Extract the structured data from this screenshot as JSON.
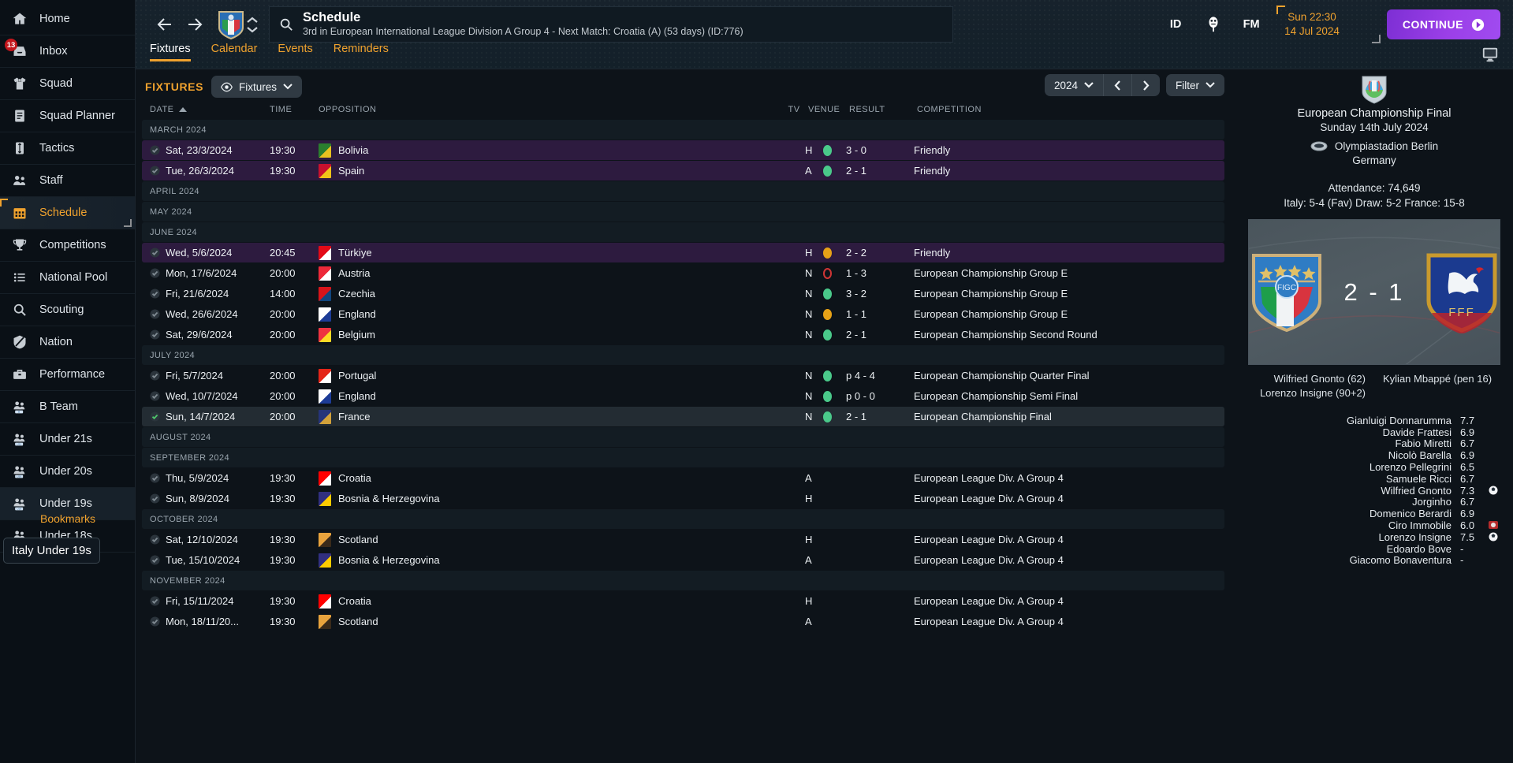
{
  "sidebar": {
    "items": [
      {
        "label": "Home",
        "icon": "home-icon",
        "badge": null
      },
      {
        "label": "Inbox",
        "icon": "inbox-icon",
        "badge": "13"
      },
      {
        "label": "Squad",
        "icon": "shirt-icon",
        "badge": null
      },
      {
        "label": "Squad Planner",
        "icon": "document-icon",
        "badge": null
      },
      {
        "label": "Tactics",
        "icon": "tactics-icon",
        "badge": null
      },
      {
        "label": "Staff",
        "icon": "staff-icon",
        "badge": null
      },
      {
        "label": "Schedule",
        "icon": "calendar-icon",
        "badge": null
      },
      {
        "label": "Competitions",
        "icon": "trophy-icon",
        "badge": null
      },
      {
        "label": "National Pool",
        "icon": "list-icon",
        "badge": null
      },
      {
        "label": "Scouting",
        "icon": "search-icon",
        "badge": null
      },
      {
        "label": "Nation",
        "icon": "shield-icon",
        "badge": null
      },
      {
        "label": "Performance",
        "icon": "briefcase-icon",
        "badge": null
      },
      {
        "label": "B Team",
        "icon": "team-b-icon",
        "badge": null
      },
      {
        "label": "Under 21s",
        "icon": "team-u21-icon",
        "badge": null
      },
      {
        "label": "Under 20s",
        "icon": "team-u20-icon",
        "badge": null
      },
      {
        "label": "Under 19s",
        "icon": "team-u19-icon",
        "badge": null
      },
      {
        "label": "Under 18s",
        "icon": "team-u18-icon",
        "badge": null
      }
    ],
    "selected": "Schedule",
    "highlighted": "Under 19s",
    "bookmarks_label": "Bookmarks",
    "tooltip": "Italy Under 19s"
  },
  "header": {
    "title": "Schedule",
    "subtitle": "3rd in European International League Division A Group 4 - Next Match: Croatia (A) (53 days) (ID:776)",
    "icons": [
      "back-arrow-icon",
      "forward-arrow-icon",
      "team-crest-icon",
      "up-down-icon",
      "search-icon"
    ],
    "right_icons": [
      "ID",
      "podcast-icon",
      "FM"
    ],
    "date_time": "Sun 22:30",
    "date_day": "14 Jul 2024",
    "continue_label": "CONTINUE",
    "tabs": [
      {
        "label": "Fixtures",
        "active": true
      },
      {
        "label": "Calendar",
        "active": false
      },
      {
        "label": "Events",
        "active": false
      },
      {
        "label": "Reminders",
        "active": false
      }
    ]
  },
  "toolbar": {
    "section_title": "FIXTURES",
    "view_pill": "Fixtures",
    "year": "2024",
    "filter_label": "Filter",
    "prev_icon": "chevron-left-icon",
    "next_icon": "chevron-right-icon"
  },
  "table": {
    "columns": [
      "DATE",
      "TIME",
      "OPPOSITION",
      "TV",
      "VENUE",
      "RESULT",
      "COMPETITION"
    ],
    "sort_column": "DATE",
    "rows": [
      {
        "type": "month",
        "label": "MARCH 2024"
      },
      {
        "type": "match",
        "date": "Sat, 23/3/2024",
        "time": "19:30",
        "opposition": "Bolivia",
        "flag": "#2a7d2e",
        "flag2": "#e8c120",
        "tv": "",
        "venue": "H",
        "result_dot": "w",
        "result": "3 - 0",
        "competition": "Friendly",
        "played": true,
        "highlight": "res"
      },
      {
        "type": "match",
        "date": "Tue, 26/3/2024",
        "time": "19:30",
        "opposition": "Spain",
        "flag": "#c8102e",
        "flag2": "#f0c419",
        "tv": "",
        "venue": "A",
        "result_dot": "w",
        "result": "2 - 1",
        "competition": "Friendly",
        "played": true,
        "highlight": "res"
      },
      {
        "type": "month",
        "label": "APRIL 2024"
      },
      {
        "type": "month",
        "label": "MAY 2024"
      },
      {
        "type": "month",
        "label": "JUNE 2024"
      },
      {
        "type": "match",
        "date": "Wed, 5/6/2024",
        "time": "20:45",
        "opposition": "Türkiye",
        "flag": "#e30a17",
        "flag2": "#ffffff",
        "tv": "",
        "venue": "H",
        "result_dot": "d",
        "result": "2 - 2",
        "competition": "Friendly",
        "played": true,
        "highlight": "res"
      },
      {
        "type": "match",
        "date": "Mon, 17/6/2024",
        "time": "20:00",
        "opposition": "Austria",
        "flag": "#ed2939",
        "flag2": "#ffffff",
        "tv": "",
        "venue": "N",
        "result_dot": "l",
        "result": "1 - 3",
        "competition": "European Championship Group E",
        "played": true,
        "highlight": ""
      },
      {
        "type": "match",
        "date": "Fri, 21/6/2024",
        "time": "14:00",
        "opposition": "Czechia",
        "flag": "#d7141a",
        "flag2": "#11457e",
        "tv": "",
        "venue": "N",
        "result_dot": "w",
        "result": "3 - 2",
        "competition": "European Championship Group E",
        "played": true,
        "highlight": ""
      },
      {
        "type": "match",
        "date": "Wed, 26/6/2024",
        "time": "20:00",
        "opposition": "England",
        "flag": "#ffffff",
        "flag2": "#1d3c97",
        "tv": "",
        "venue": "N",
        "result_dot": "d",
        "result": "1 - 1",
        "competition": "European Championship Group E",
        "played": true,
        "highlight": ""
      },
      {
        "type": "match",
        "date": "Sat, 29/6/2024",
        "time": "20:00",
        "opposition": "Belgium",
        "flag": "#ef3340",
        "flag2": "#fdda24",
        "tv": "",
        "venue": "N",
        "result_dot": "w",
        "result": "2 - 1",
        "competition": "European Championship Second Round",
        "played": true,
        "highlight": ""
      },
      {
        "type": "month",
        "label": "JULY 2024"
      },
      {
        "type": "match",
        "date": "Fri, 5/7/2024",
        "time": "20:00",
        "opposition": "Portugal",
        "flag": "#e42518",
        "flag2": "#ffffff",
        "tv": "",
        "venue": "N",
        "result_dot": "w",
        "result": "p 4 - 4",
        "competition": "European Championship Quarter Final",
        "played": true,
        "highlight": ""
      },
      {
        "type": "match",
        "date": "Wed, 10/7/2024",
        "time": "20:00",
        "opposition": "England",
        "flag": "#ffffff",
        "flag2": "#1d3c97",
        "tv": "",
        "venue": "N",
        "result_dot": "w",
        "result": "p 0 - 0",
        "competition": "European Championship Semi Final",
        "played": true,
        "highlight": ""
      },
      {
        "type": "match",
        "date": "Sun, 14/7/2024",
        "time": "20:00",
        "opposition": "France",
        "flag": "#26347a",
        "flag2": "#d2a13a",
        "tv": "",
        "venue": "N",
        "result_dot": "w",
        "result": "2 - 1",
        "competition": "European Championship Final",
        "played": true,
        "highlight": "cur",
        "done": true
      },
      {
        "type": "month",
        "label": "AUGUST 2024"
      },
      {
        "type": "month",
        "label": "SEPTEMBER 2024"
      },
      {
        "type": "match",
        "date": "Thu, 5/9/2024",
        "time": "19:30",
        "opposition": "Croatia",
        "flag": "#ff0000",
        "flag2": "#ffffff",
        "tv": "",
        "venue": "A",
        "result_dot": "",
        "result": "",
        "competition": "European League Div. A Group 4",
        "played": false,
        "highlight": ""
      },
      {
        "type": "match",
        "date": "Sun, 8/9/2024",
        "time": "19:30",
        "opposition": "Bosnia & Herzegovina",
        "flag": "#312f80",
        "flag2": "#fecb00",
        "tv": "",
        "venue": "H",
        "result_dot": "",
        "result": "",
        "competition": "European League Div. A Group 4",
        "played": false,
        "highlight": ""
      },
      {
        "type": "month",
        "label": "OCTOBER 2024"
      },
      {
        "type": "match",
        "date": "Sat, 12/10/2024",
        "time": "19:30",
        "opposition": "Scotland",
        "flag": "#e8a33d",
        "flag2": "#3a2a1a",
        "tv": "",
        "venue": "H",
        "result_dot": "",
        "result": "",
        "competition": "European League Div. A Group 4",
        "played": false,
        "highlight": ""
      },
      {
        "type": "match",
        "date": "Tue, 15/10/2024",
        "time": "19:30",
        "opposition": "Bosnia & Herzegovina",
        "flag": "#312f80",
        "flag2": "#fecb00",
        "tv": "",
        "venue": "A",
        "result_dot": "",
        "result": "",
        "competition": "European League Div. A Group 4",
        "played": false,
        "highlight": ""
      },
      {
        "type": "month",
        "label": "NOVEMBER 2024"
      },
      {
        "type": "match",
        "date": "Fri, 15/11/2024",
        "time": "19:30",
        "opposition": "Croatia",
        "flag": "#ff0000",
        "flag2": "#ffffff",
        "tv": "",
        "venue": "H",
        "result_dot": "",
        "result": "",
        "competition": "European League Div. A Group 4",
        "played": false,
        "highlight": ""
      },
      {
        "type": "match",
        "date": "Mon, 18/11/20...",
        "time": "19:30",
        "opposition": "Scotland",
        "flag": "#e8a33d",
        "flag2": "#3a2a1a",
        "tv": "",
        "venue": "A",
        "result_dot": "",
        "result": "",
        "competition": "European League Div. A Group 4",
        "played": false,
        "highlight": ""
      }
    ]
  },
  "match_panel": {
    "competition": "European Championship Final",
    "date": "Sunday 14th July 2024",
    "stadium": "Olympiastadion Berlin",
    "country": "Germany",
    "attendance": "Attendance: 74,649",
    "odds": "Italy: 5-4 (Fav) Draw: 5-2 France: 15-8",
    "score": "2 - 1",
    "home_team": "Italy",
    "away_team": "France",
    "scorers_home": [
      "Wilfried Gnonto (62)",
      "Lorenzo Insigne (90+2)"
    ],
    "scorers_away": [
      "Kylian Mbappé (pen 16)"
    ],
    "ratings": [
      {
        "name": "Gianluigi Donnarumma",
        "rating": "7.7",
        "icon": ""
      },
      {
        "name": "Davide Frattesi",
        "rating": "6.9",
        "icon": ""
      },
      {
        "name": "Fabio Miretti",
        "rating": "6.7",
        "icon": ""
      },
      {
        "name": "Nicolò Barella",
        "rating": "6.9",
        "icon": ""
      },
      {
        "name": "Lorenzo Pellegrini",
        "rating": "6.5",
        "icon": ""
      },
      {
        "name": "Samuele Ricci",
        "rating": "6.7",
        "icon": ""
      },
      {
        "name": "Wilfried Gnonto",
        "rating": "7.3",
        "icon": "ball"
      },
      {
        "name": "Jorginho",
        "rating": "6.7",
        "icon": ""
      },
      {
        "name": "Domenico Berardi",
        "rating": "6.9",
        "icon": ""
      },
      {
        "name": "Ciro Immobile",
        "rating": "6.0",
        "icon": "red-card"
      },
      {
        "name": "Lorenzo Insigne",
        "rating": "7.5",
        "icon": "ball"
      },
      {
        "name": "Edoardo Bove",
        "rating": "-",
        "icon": ""
      },
      {
        "name": "Giacomo Bonaventura",
        "rating": "-",
        "icon": ""
      }
    ]
  },
  "colors": {
    "accent": "#f0a22e",
    "continue": "#9b3fe8",
    "win": "#4ac98a",
    "draw": "#e6a117",
    "loss": "#cf3535"
  }
}
